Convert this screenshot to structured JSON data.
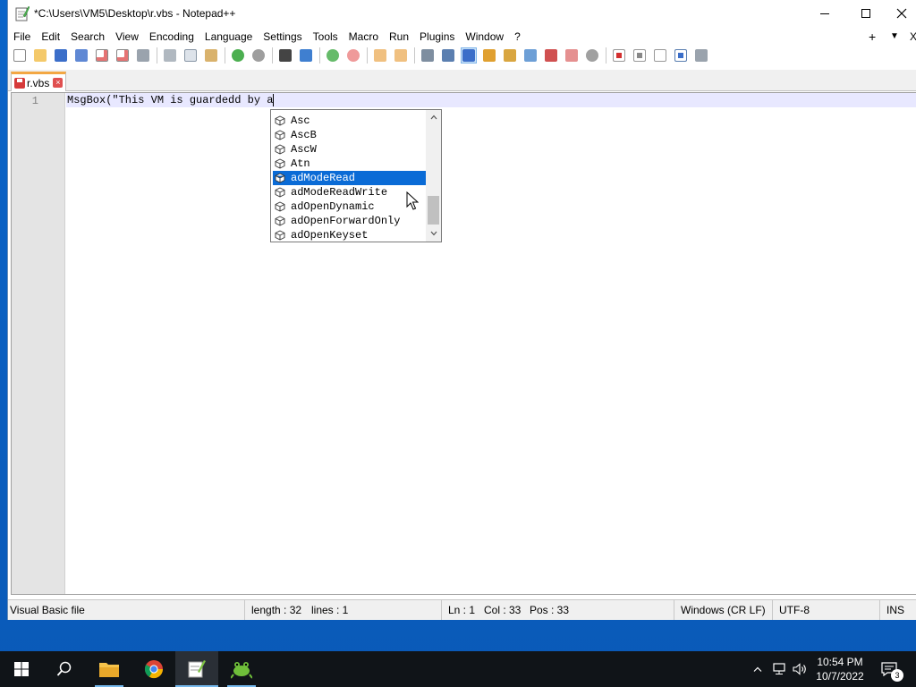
{
  "window": {
    "title": "*C:\\Users\\VM5\\Desktop\\r.vbs - Notepad++"
  },
  "menu": {
    "items": [
      "File",
      "Edit",
      "Search",
      "View",
      "Encoding",
      "Language",
      "Settings",
      "Tools",
      "Macro",
      "Run",
      "Plugins",
      "Window",
      "?"
    ],
    "plus": "+",
    "dropdown": "▼",
    "close": "X"
  },
  "tab": {
    "label": "r.vbs",
    "close": "×"
  },
  "editor": {
    "line_number": "1",
    "code": "MsgBox(\"This VM is guardedd by a"
  },
  "autocomplete": {
    "items": [
      "Asc",
      "AscB",
      "AscW",
      "Atn",
      "adModeRead",
      "adModeReadWrite",
      "adOpenDynamic",
      "adOpenForwardOnly",
      "adOpenKeyset"
    ],
    "selected_index": 4
  },
  "status": {
    "file_type": "Visual Basic file",
    "length": "length : 32",
    "lines": "lines : 1",
    "ln": "Ln : 1",
    "col": "Col : 33",
    "pos": "Pos : 33",
    "eol": "Windows (CR LF)",
    "encoding": "UTF-8",
    "mode": "INS"
  },
  "taskbar": {
    "time": "10:54 PM",
    "date": "10/7/2022",
    "notifications": "3"
  },
  "colors": {
    "accent": "#0a6bd6",
    "tab_accent": "#f3a743",
    "desktop": "#0a64c8"
  }
}
